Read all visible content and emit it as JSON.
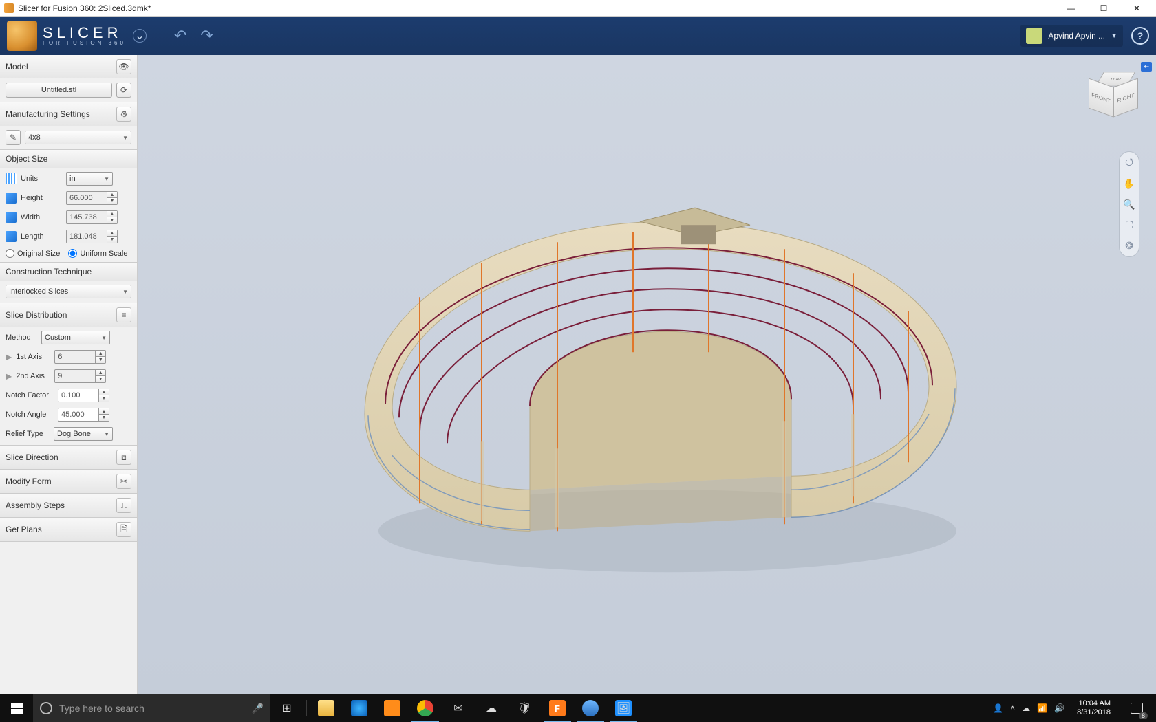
{
  "titlebar": {
    "title": "Slicer for Fusion 360: 2Sliced.3dmk*"
  },
  "toolbar": {
    "brand": "SLICER",
    "brand_sub": "FOR FUSION 360",
    "user_name": "Apvind Apvin ..."
  },
  "panels": {
    "model": {
      "header": "Model",
      "file_label": "Untitled.stl"
    },
    "manufacturing": {
      "header": "Manufacturing Settings",
      "preset": "4x8"
    },
    "object_size": {
      "header": "Object Size",
      "units_label": "Units",
      "units_value": "in",
      "height_label": "Height",
      "height_value": "66.000",
      "width_label": "Width",
      "width_value": "145.738",
      "length_label": "Length",
      "length_value": "181.048",
      "original_size": "Original Size",
      "uniform_scale": "Uniform Scale"
    },
    "construction": {
      "header": "Construction Technique",
      "value": "Interlocked Slices"
    },
    "slice_dist": {
      "header": "Slice Distribution",
      "method_label": "Method",
      "method_value": "Custom",
      "axis1_label": "1st Axis",
      "axis1_value": "6",
      "axis2_label": "2nd Axis",
      "axis2_value": "9",
      "notch_factor_label": "Notch Factor",
      "notch_factor_value": "0.100",
      "notch_angle_label": "Notch Angle",
      "notch_angle_value": "45.000",
      "relief_label": "Relief Type",
      "relief_value": "Dog Bone"
    },
    "slice_direction": {
      "header": "Slice Direction"
    },
    "modify_form": {
      "header": "Modify Form"
    },
    "assembly_steps": {
      "header": "Assembly Steps"
    },
    "get_plans": {
      "header": "Get Plans"
    }
  },
  "viewcube": {
    "front": "FRONT",
    "right": "RIGHT",
    "top": "TOP"
  },
  "taskbar": {
    "search_placeholder": "Type here to search",
    "time": "10:04 AM",
    "date": "8/31/2018",
    "notif_count": "8"
  }
}
